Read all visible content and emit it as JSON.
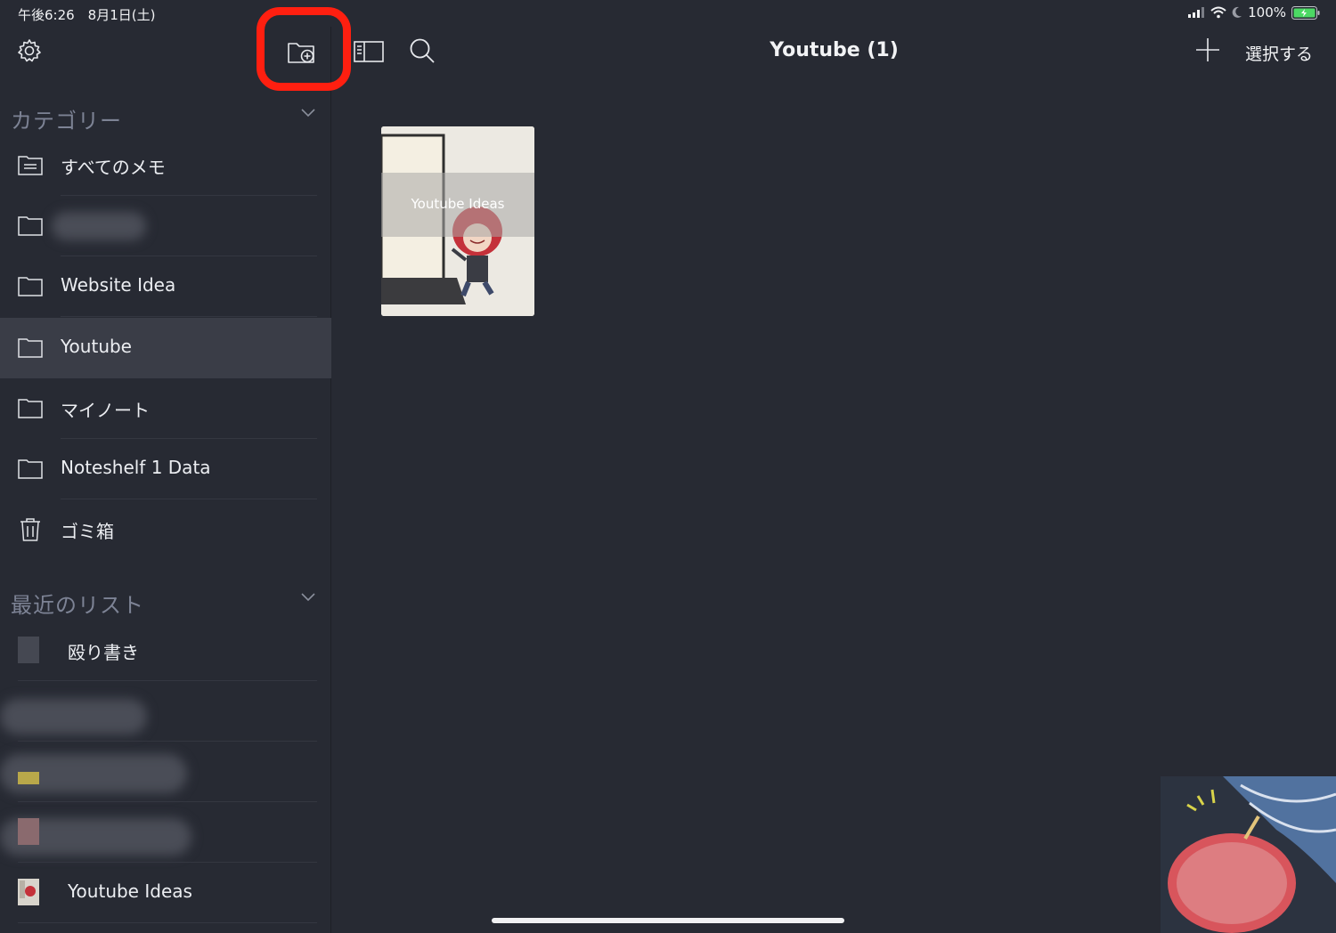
{
  "status_bar": {
    "time": "午後6:26　8月1日(土)",
    "battery": "100%"
  },
  "sidebar": {
    "categories_header": "カテゴリー",
    "categories": [
      {
        "label": "すべてのメモ",
        "icon": "all-notes-icon"
      },
      {
        "label": "",
        "icon": "folder-icon",
        "redacted": true
      },
      {
        "label": "Website Idea",
        "icon": "folder-icon"
      },
      {
        "label": "Youtube",
        "icon": "folder-icon",
        "selected": true
      },
      {
        "label": "マイノート",
        "icon": "folder-icon"
      },
      {
        "label": "Noteshelf 1 Data",
        "icon": "folder-icon"
      },
      {
        "label": "ゴミ箱",
        "icon": "trash-icon"
      }
    ],
    "recent_header": "最近のリスト",
    "recent": [
      {
        "label": "殴り書き"
      },
      {
        "label": "",
        "redacted": true
      },
      {
        "label": "",
        "redacted": true
      },
      {
        "label": "",
        "redacted": true
      },
      {
        "label": "Youtube Ideas"
      }
    ]
  },
  "main": {
    "title": "Youtube (1)",
    "select_label": "選択する",
    "notes": [
      {
        "title": "Youtube Ideas"
      }
    ]
  },
  "colors": {
    "background": "#272a33",
    "selected_row": "#3a3d47",
    "highlight": "#ff1f10"
  }
}
